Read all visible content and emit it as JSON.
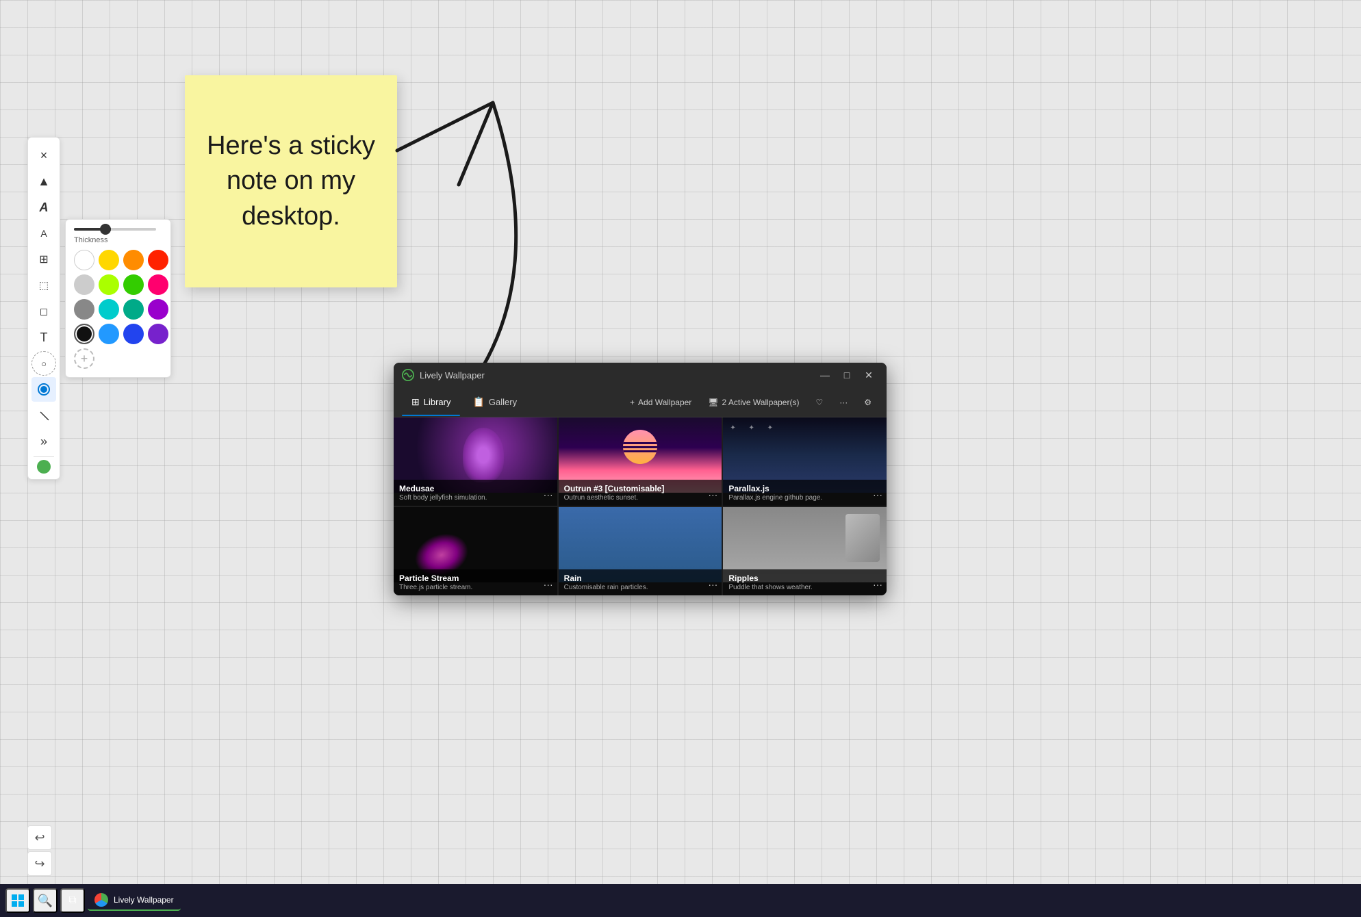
{
  "app": {
    "title": "Lively Wallpaper",
    "background_color": "#e8e8e8"
  },
  "sticky_note": {
    "text": "Here's a sticky note on my desktop."
  },
  "drawing_toolbar": {
    "close_label": "×",
    "tools": [
      {
        "name": "pointer",
        "icon": "▲",
        "active": false
      },
      {
        "name": "text",
        "icon": "A",
        "active": false
      },
      {
        "name": "font-size",
        "icon": "A",
        "active": false
      },
      {
        "name": "table",
        "icon": "⊞",
        "active": false
      },
      {
        "name": "shape",
        "icon": "⬚",
        "active": false
      },
      {
        "name": "eraser",
        "icon": "◻",
        "active": false
      },
      {
        "name": "text-insert",
        "icon": "T",
        "active": false
      },
      {
        "name": "lasso",
        "icon": "⬭",
        "active": false
      },
      {
        "name": "pen",
        "icon": "⬤",
        "active": true
      },
      {
        "name": "line",
        "icon": "∕",
        "active": false
      },
      {
        "name": "more",
        "icon": "»",
        "active": false
      }
    ],
    "thickness_label": "Thickness",
    "colors": [
      {
        "hex": "#ffffff",
        "name": "white"
      },
      {
        "hex": "#ffd700",
        "name": "yellow"
      },
      {
        "hex": "#ff8c00",
        "name": "orange"
      },
      {
        "hex": "#ff2200",
        "name": "red"
      },
      {
        "hex": "#cccccc",
        "name": "light-gray"
      },
      {
        "hex": "#aaff00",
        "name": "lime"
      },
      {
        "hex": "#33cc00",
        "name": "green"
      },
      {
        "hex": "#ff006e",
        "name": "pink"
      },
      {
        "hex": "#888888",
        "name": "gray"
      },
      {
        "hex": "#00cccc",
        "name": "teal"
      },
      {
        "hex": "#00aa88",
        "name": "dark-teal"
      },
      {
        "hex": "#9900cc",
        "name": "purple"
      },
      {
        "hex": "#111111",
        "name": "black",
        "selected": true
      },
      {
        "hex": "#2299ff",
        "name": "blue"
      },
      {
        "hex": "#2244ee",
        "name": "dark-blue"
      },
      {
        "hex": "#7722cc",
        "name": "violet"
      }
    ]
  },
  "lively_window": {
    "title": "Lively Wallpaper",
    "tabs": [
      {
        "label": "Library",
        "icon": "⊞",
        "active": true
      },
      {
        "label": "Gallery",
        "icon": "📋",
        "active": false
      }
    ],
    "toolbar_actions": [
      {
        "label": "Add Wallpaper",
        "icon": "+"
      },
      {
        "label": "2 Active Wallpaper(s)",
        "icon": "🖥"
      },
      {
        "label": "♡",
        "icon": ""
      },
      {
        "label": "...",
        "icon": ""
      },
      {
        "label": "⚙",
        "icon": ""
      }
    ],
    "wallpapers": [
      {
        "id": "medusae",
        "name": "Medusae",
        "description": "Soft body jellyfish simulation.",
        "thumb_type": "medusae"
      },
      {
        "id": "outrun3",
        "name": "Outrun #3 [Customisable]",
        "description": "Outrun aesthetic sunset.",
        "thumb_type": "outrun"
      },
      {
        "id": "parallaxjs",
        "name": "Parallax.js",
        "description": "Parallax.js engine github page.",
        "thumb_type": "parallax"
      },
      {
        "id": "particle-stream",
        "name": "Particle Stream",
        "description": "Three.js particle stream.",
        "thumb_type": "particle"
      },
      {
        "id": "rain",
        "name": "Rain",
        "description": "Customisable rain particles.",
        "thumb_type": "rain"
      },
      {
        "id": "ripples",
        "name": "Ripples",
        "description": "Puddle that shows weather.",
        "thumb_type": "ripples"
      }
    ]
  },
  "taskbar": {
    "start_label": "⊞",
    "search_label": "🔍",
    "task_view_label": "⧉",
    "app_label": "Lively Wallpaper"
  }
}
